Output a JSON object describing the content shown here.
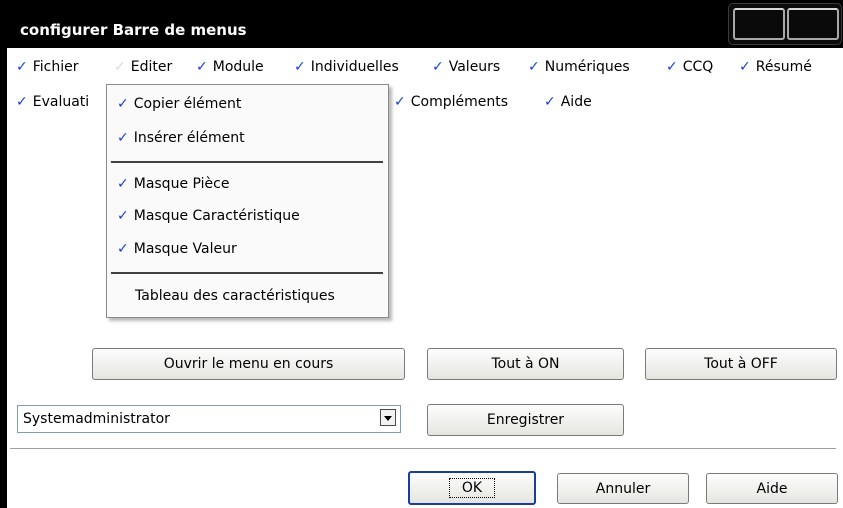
{
  "window": {
    "title": "configurer Barre de menus"
  },
  "check_glyph": "✓",
  "menubar": {
    "row1": [
      {
        "label": "Fichier",
        "checked": true
      },
      {
        "label": "Editer",
        "checked": false
      },
      {
        "label": "Module",
        "checked": true
      },
      {
        "label": "Individuelles",
        "checked": true
      },
      {
        "label": "Valeurs",
        "checked": true
      },
      {
        "label": "Numériques",
        "checked": true
      },
      {
        "label": "CCQ",
        "checked": true
      },
      {
        "label": "Résumé",
        "checked": true
      }
    ],
    "row2": [
      {
        "label": "Evaluati",
        "checked": true
      },
      {
        "label": "Compléments",
        "checked": true
      },
      {
        "label": "Aide",
        "checked": true
      }
    ]
  },
  "dropdown": {
    "items": [
      {
        "label": "Copier élément",
        "checked": true
      },
      {
        "label": "Insérer élément",
        "checked": true
      },
      {
        "label": "Masque Pièce",
        "checked": true
      },
      {
        "label": "Masque Caractéristique",
        "checked": true
      },
      {
        "label": "Masque Valeur",
        "checked": true
      },
      {
        "label": "Tableau des caractéristiques",
        "checked": false
      }
    ]
  },
  "buttons": {
    "open_menu": "Ouvrir le menu en cours",
    "all_on": "Tout à ON",
    "all_off": "Tout à OFF",
    "save": "Enregistrer",
    "ok": "OK",
    "cancel": "Annuler",
    "help": "Aide"
  },
  "user_select": {
    "value": "Systemadministrator"
  },
  "colors": {
    "check": "#1a3fd4",
    "titlebar": "#000000"
  }
}
